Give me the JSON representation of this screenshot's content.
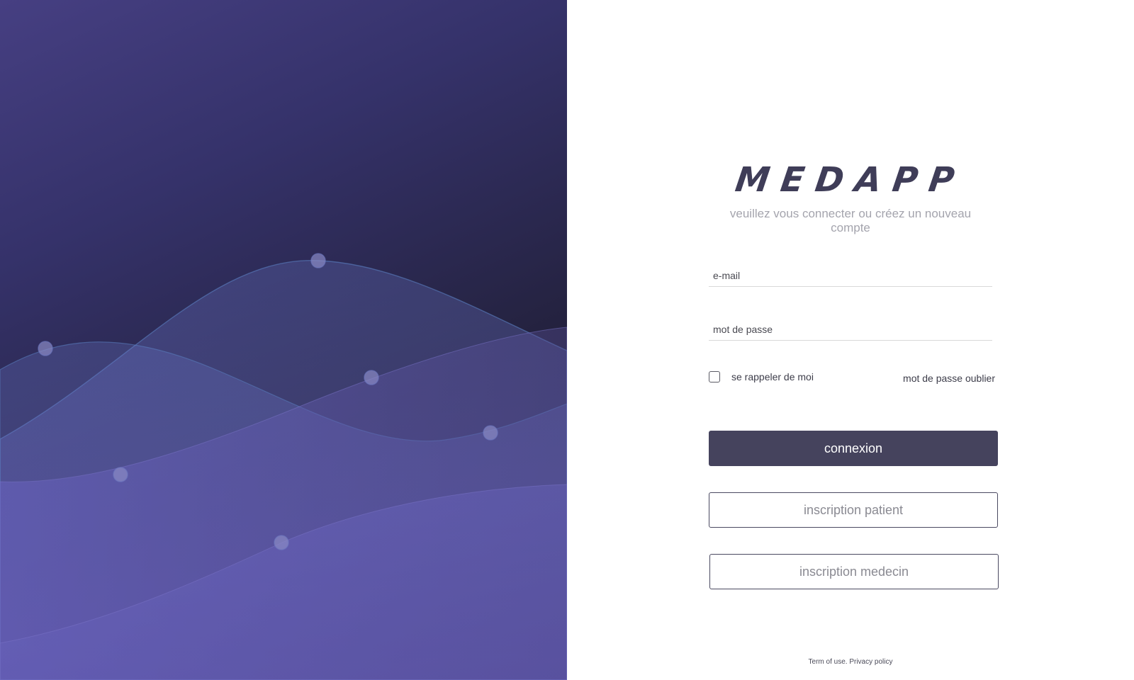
{
  "app": {
    "logo_text": "MEDAPP",
    "subtitle": "veuillez  vous connecter ou créez un nouveau compte"
  },
  "form": {
    "email_placeholder": "e-mail",
    "password_placeholder": "mot de passe",
    "remember_label": "se rappeler de moi",
    "remember_checked": false,
    "forgot_label": "mot de passe oublier"
  },
  "buttons": {
    "login_label": "connexion",
    "register_patient_label": "inscription patient",
    "register_doctor_label": "inscription medecin"
  },
  "footer": {
    "terms_label": "Term of use.",
    "privacy_label": "Privacy policy"
  },
  "colors": {
    "primary": "#45435d",
    "hero_dark": "#1f1d35",
    "hero_light": "#6460b5"
  }
}
